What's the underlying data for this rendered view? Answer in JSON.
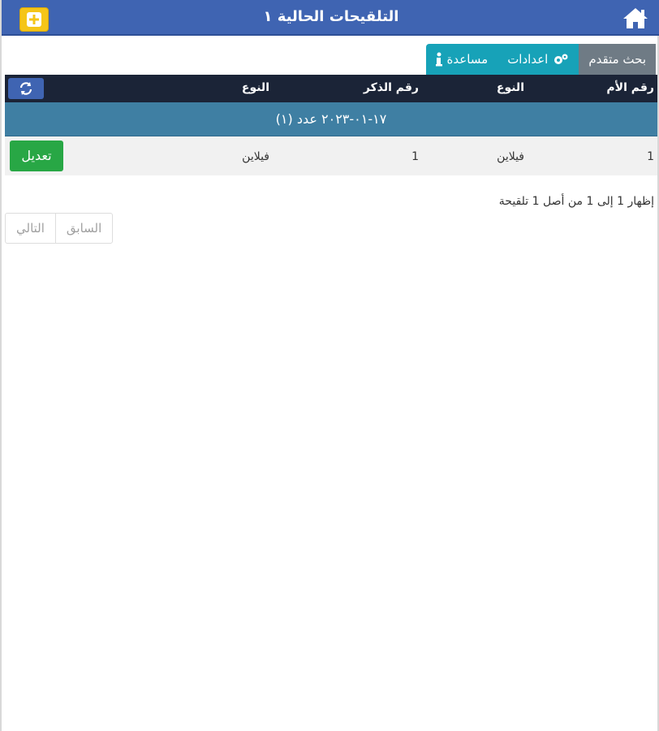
{
  "header": {
    "title": "التلقيحات الحالية ١",
    "bg_color": "#3f64b2"
  },
  "toolbar": {
    "advanced_search": "بحث متقدم",
    "settings": "اعدادات",
    "help": "مساعدة"
  },
  "table": {
    "columns": [
      "رقم الأم",
      "النوع",
      "رقم الذكر",
      "النوع"
    ],
    "group_label": "١٧-٠١-٢٠٢٣ عدد (١)",
    "rows": [
      {
        "mother_no": "1",
        "type": "فيلاين",
        "male_no": "1",
        "type2": "فيلاين",
        "edit_label": "تعديل"
      }
    ]
  },
  "summary": "إظهار 1 إلى 1 من أصل 1 تلقيحة",
  "pagination": {
    "previous": "السابق",
    "next": "التالي"
  },
  "icons": {
    "home": "home-icon",
    "add": "plus-icon",
    "settings": "gears-icon",
    "help": "info-icon",
    "refresh": "refresh-icon"
  }
}
